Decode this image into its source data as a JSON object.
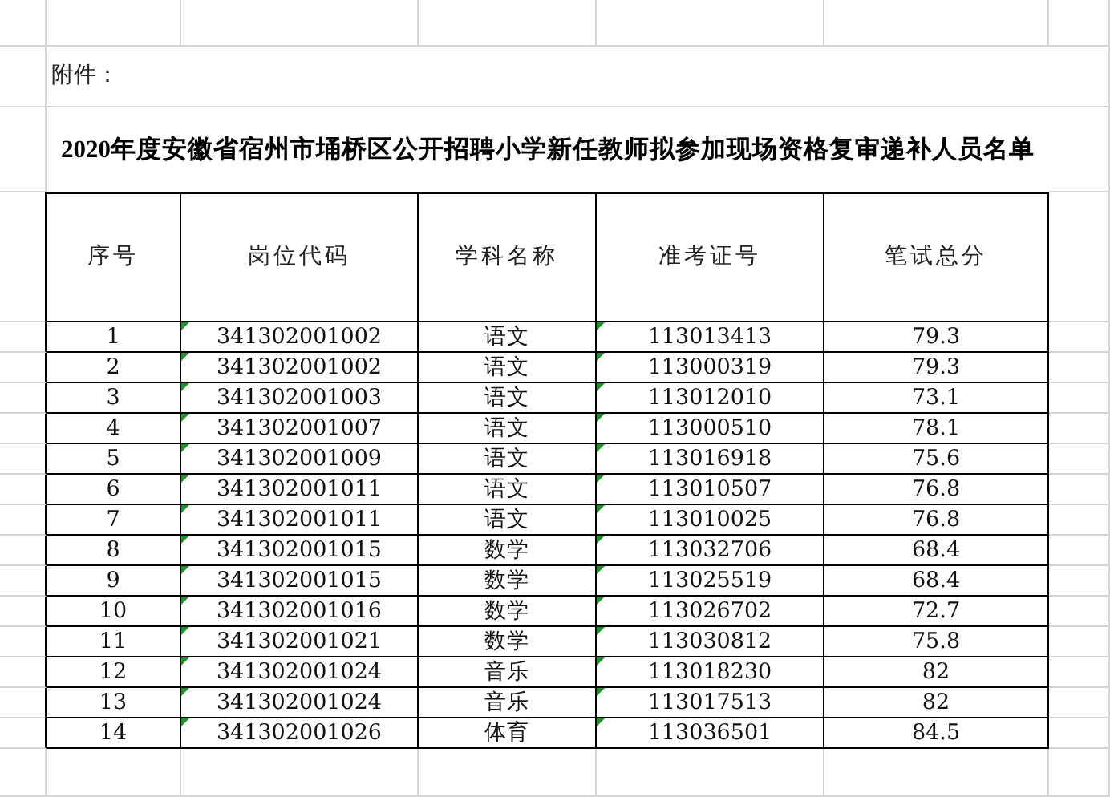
{
  "note": "附件：",
  "title": "2020年度安徽省宿州市埇桥区公开招聘小学新任教师拟参加现场资格复审递补人员名单",
  "columns": [
    {
      "label": "序号",
      "stored_as_text": false
    },
    {
      "label": "岗位代码",
      "stored_as_text": true
    },
    {
      "label": "学科名称",
      "stored_as_text": false
    },
    {
      "label": "准考证号",
      "stored_as_text": true
    },
    {
      "label": "笔试总分",
      "stored_as_text": false
    }
  ],
  "rows": [
    [
      "1",
      "341302001002",
      "语文",
      "113013413",
      "79.3"
    ],
    [
      "2",
      "341302001002",
      "语文",
      "113000319",
      "79.3"
    ],
    [
      "3",
      "341302001003",
      "语文",
      "113012010",
      "73.1"
    ],
    [
      "4",
      "341302001007",
      "语文",
      "113000510",
      "78.1"
    ],
    [
      "5",
      "341302001009",
      "语文",
      "113016918",
      "75.6"
    ],
    [
      "6",
      "341302001011",
      "语文",
      "113010507",
      "76.8"
    ],
    [
      "7",
      "341302001011",
      "语文",
      "113010025",
      "76.8"
    ],
    [
      "8",
      "341302001015",
      "数学",
      "113032706",
      "68.4"
    ],
    [
      "9",
      "341302001015",
      "数学",
      "113025519",
      "68.4"
    ],
    [
      "10",
      "341302001016",
      "数学",
      "113026702",
      "72.7"
    ],
    [
      "11",
      "341302001021",
      "数学",
      "113030812",
      "75.8"
    ],
    [
      "12",
      "341302001024",
      "音乐",
      "113018230",
      "82"
    ],
    [
      "13",
      "341302001024",
      "音乐",
      "113017513",
      "82"
    ],
    [
      "14",
      "341302001026",
      "体育",
      "113036501",
      "84.5"
    ]
  ]
}
